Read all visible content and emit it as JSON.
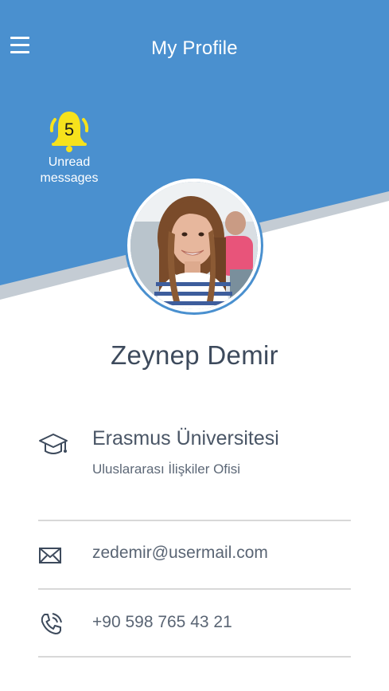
{
  "header": {
    "title": "My Profile",
    "background_color": "#4a90cf"
  },
  "notifications": {
    "count": "5",
    "label_line1": "Unread",
    "label_line2": "messages",
    "bell_color": "#f6e21c"
  },
  "profile": {
    "name": "Zeynep Demir"
  },
  "education": {
    "university": "Erasmus Üniversitesi",
    "department": "Uluslararası İlişkiler Ofisi",
    "icon": "graduation-cap-icon"
  },
  "contact": {
    "email": "zedemir@usermail.com",
    "email_icon": "envelope-icon",
    "phone": "+90 598 765 43 21",
    "phone_icon": "phone-icon"
  }
}
